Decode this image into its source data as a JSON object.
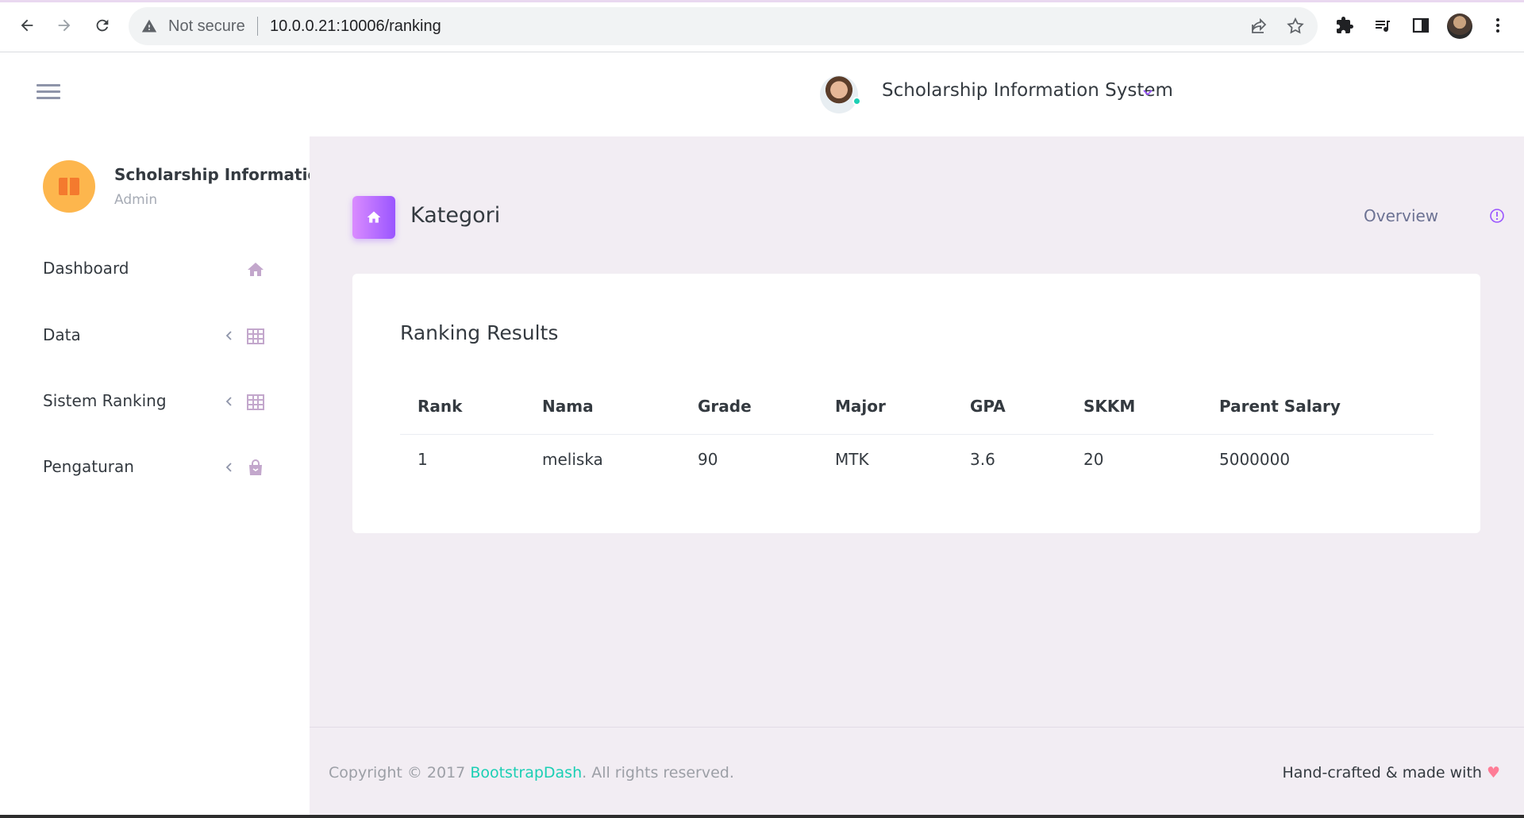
{
  "browser": {
    "security_label": "Not secure",
    "url": "10.0.0.21:10006/ranking"
  },
  "header": {
    "title": "Scholarship Information System"
  },
  "sidebar": {
    "brand_name": "Scholarship Information",
    "brand_role": "Admin",
    "items": [
      {
        "label": "Dashboard",
        "icon": "home-icon"
      },
      {
        "label": "Data",
        "icon": "grid-icon"
      },
      {
        "label": "Sistem Ranking",
        "icon": "grid-icon"
      },
      {
        "label": "Pengaturan",
        "icon": "bag-icon"
      }
    ]
  },
  "page": {
    "title": "Kategori",
    "overview_label": "Overview"
  },
  "card": {
    "title": "Ranking Results",
    "columns": [
      "Rank",
      "Nama",
      "Grade",
      "Major",
      "GPA",
      "SKKM",
      "Parent Salary"
    ],
    "rows": [
      [
        "1",
        "meliska",
        "90",
        "MTK",
        "3.6",
        "20",
        "5000000"
      ]
    ]
  },
  "footer": {
    "copyright_prefix": "Copyright © 2017 ",
    "link_text": "BootstrapDash",
    "copyright_suffix": ". All rights reserved.",
    "right_text": "Hand-crafted & made with",
    "heart": "♥"
  },
  "colors": {
    "accent_gradient_start": "#da8cff",
    "accent_gradient_end": "#9a55ff",
    "link": "#1bcfb4",
    "content_bg": "#f2edf3",
    "brand_avatar": "#fdb64d"
  }
}
